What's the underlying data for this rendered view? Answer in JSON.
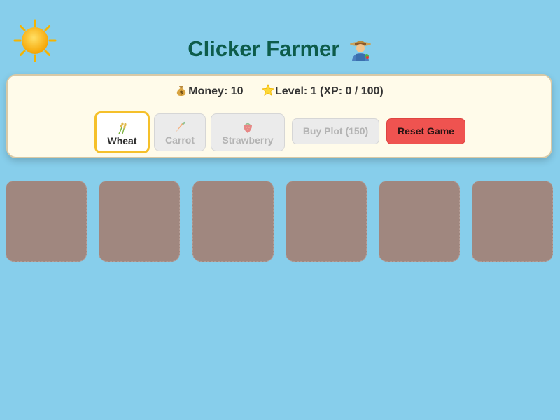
{
  "header": {
    "title": "Clicker Farmer",
    "sun_icon": "sun-icon",
    "farmer_icon": "farmer-icon"
  },
  "stats": {
    "money_icon": "money-bag-icon",
    "money_text": "Money: 10",
    "level_icon": "star-icon",
    "level_text": "Level: 1 (XP: 0 / 100)"
  },
  "crops": [
    {
      "label": "Wheat",
      "icon": "wheat-icon",
      "state": "selected"
    },
    {
      "label": "Carrot",
      "icon": "carrot-icon",
      "state": "disabled"
    },
    {
      "label": "Strawberry",
      "icon": "strawberry-icon",
      "state": "disabled"
    }
  ],
  "actions": {
    "buy_plot_label": "Buy Plot (150)",
    "reset_label": "Reset Game"
  },
  "plot_count": 6,
  "colors": {
    "sky": "#87ceeb",
    "title": "#0d5c4a",
    "panel_bg": "#fffbea",
    "selected_border": "#f5c02a",
    "reset_button": "#ef5350",
    "plot_soil": "#a0877f"
  }
}
